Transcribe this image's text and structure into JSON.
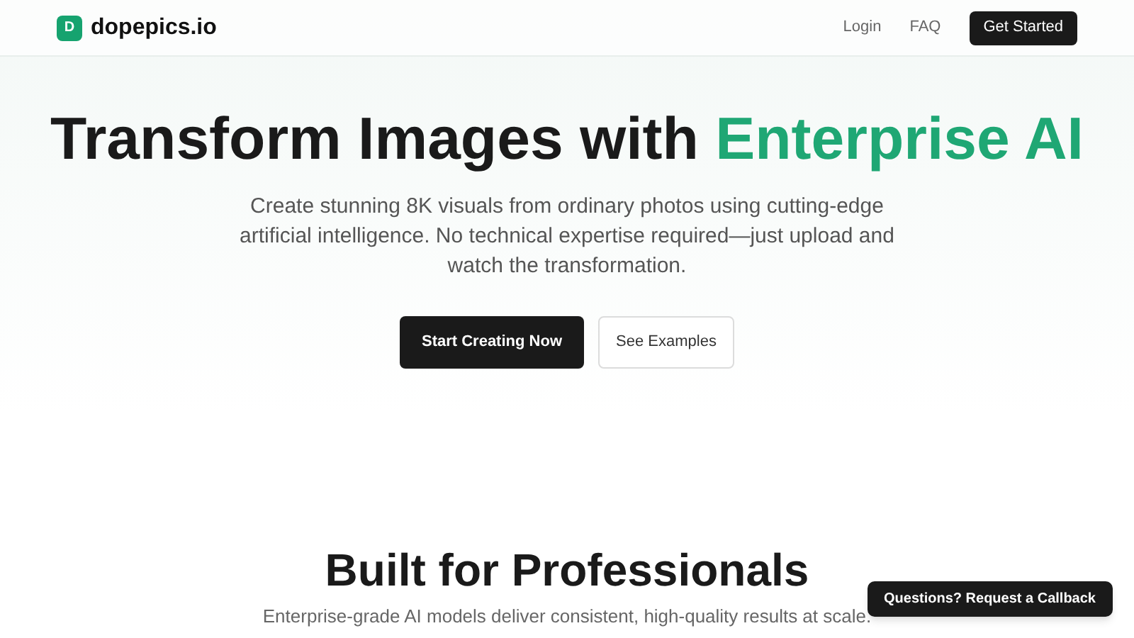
{
  "header": {
    "logo_letter": "D",
    "brand": "dopepics.io",
    "nav": [
      "Login",
      "FAQ"
    ],
    "cta": "Get Started"
  },
  "hero": {
    "title": "Transform Images with ",
    "title_highlight": "Enterprise AI",
    "subtitle": "Create stunning 8K visuals from ordinary photos using cutting-edge artificial intelligence. No technical expertise required—just upload and watch the transformation.",
    "primary_button": "Start Creating Now",
    "secondary_button": "See Examples"
  },
  "features": {
    "title": "Built for Professionals",
    "subtitle": "Enterprise-grade AI models deliver consistent, high-quality results at scale."
  },
  "callback_button": "Questions? Request a Callback"
}
